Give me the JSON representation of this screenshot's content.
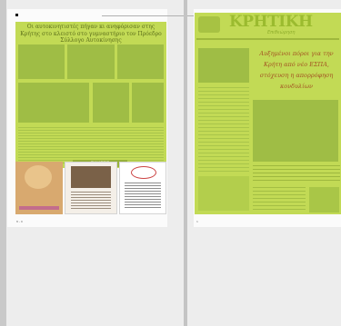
{
  "viewer": {
    "left_page": {
      "headline": "Οι αυτοκινητιστές πήγαν κι ανηφόρισαν στης Κρήτης στο κλειστό στο γυμναστήριο τον Πρόεδρο Σύλλογο Αυτοκίνησης",
      "section_tag": "ΕΙΔΗΣΕΙΣ",
      "page_number": "8 - 9"
    },
    "right_page": {
      "masthead": "ΚΡΗΤΙΚΗ",
      "subtitle": "Επιθεώρηση",
      "headline": "Αυξημένοι πόροι για την Κρήτη από νέο ΕΣΠΑ, στόχευση η απορρόφηση κονδυλίων",
      "page_number": "1"
    }
  }
}
